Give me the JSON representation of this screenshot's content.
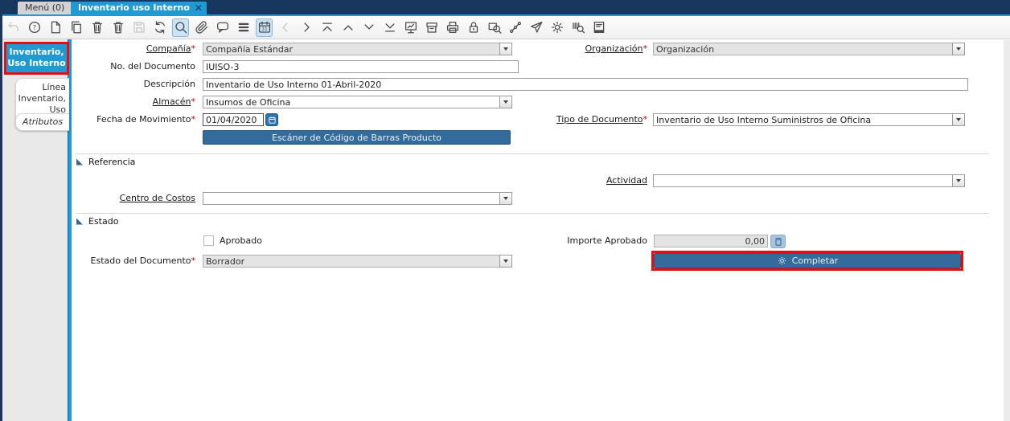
{
  "colors": {
    "navy": "#17375e",
    "accent_blue": "#1f9ad2",
    "steel_button": "#346b9d",
    "annotation_red": "#e60e0e"
  },
  "window_tabs": {
    "menu": {
      "label": "Menú (0)"
    },
    "active": {
      "label": "Inventario uso Interno",
      "close_glyph": "✕"
    }
  },
  "toolbar": {
    "icons": [
      {
        "name": "undo-icon",
        "disabled": true
      },
      {
        "name": "help-icon"
      },
      {
        "name": "new-record-icon"
      },
      {
        "name": "copy-record-icon"
      },
      {
        "name": "delete-record-icon"
      },
      {
        "name": "delete-selection-icon"
      },
      {
        "name": "save-icon",
        "disabled": true
      },
      {
        "name": "refresh-icon"
      },
      {
        "name": "find-icon",
        "highlighted": true
      },
      {
        "name": "attachment-icon"
      },
      {
        "name": "chat-icon"
      },
      {
        "name": "grid-toggle-icon"
      },
      {
        "name": "calendar-icon",
        "highlighted": true
      },
      {
        "name": "previous-icon",
        "disabled": true
      },
      {
        "name": "next-icon"
      },
      {
        "name": "first-record-icon"
      },
      {
        "name": "previous-record-icon"
      },
      {
        "name": "next-record-icon"
      },
      {
        "name": "last-record-icon"
      },
      {
        "name": "report-icon"
      },
      {
        "name": "archive-icon"
      },
      {
        "name": "print-icon"
      },
      {
        "name": "lock-icon"
      },
      {
        "name": "zoom-across-icon"
      },
      {
        "name": "workflow-icon"
      },
      {
        "name": "send-icon"
      },
      {
        "name": "process-icon"
      },
      {
        "name": "barcode-reader-icon"
      },
      {
        "name": "report-window-icon"
      }
    ]
  },
  "sidebar": {
    "tabs": [
      {
        "label": "Inventario, Uso Interno",
        "active": true,
        "highlighted": true
      },
      {
        "label": "Línea Inventario, Uso Interno"
      },
      {
        "label": "Atributos"
      }
    ]
  },
  "form": {
    "compania": {
      "label": "Compañía",
      "required": "*",
      "value": "Compañía Estándar"
    },
    "organizacion": {
      "label": "Organización",
      "required": "*",
      "value": "Organización"
    },
    "no_documento": {
      "label": "No. del Documento",
      "value": "IUISO-3"
    },
    "descripcion": {
      "label": "Descripción",
      "value": "Inventario de Uso Interno 01-Abril-2020"
    },
    "almacen": {
      "label": "Almacén",
      "required": "*",
      "value": "Insumos de Oficina"
    },
    "fecha_movimiento": {
      "label": "Fecha de Movimiento",
      "required": "*",
      "value": "01/04/2020"
    },
    "tipo_documento": {
      "label": "Tipo de Documento",
      "required": "*",
      "value": "Inventario de Uso Interno Suministros de Oficina"
    },
    "scanner_button": {
      "label": "Escáner de Código de Barras Producto"
    }
  },
  "referencia": {
    "title": "Referencia",
    "actividad": {
      "label": "Actividad",
      "value": ""
    },
    "centro_costos": {
      "label": "Centro de Costos",
      "value": ""
    }
  },
  "estado": {
    "title": "Estado",
    "aprobado": {
      "label": "Aprobado",
      "checked": false
    },
    "importe_aprobado": {
      "label": "Importe Aprobado",
      "value": "0,00"
    },
    "estado_documento": {
      "label": "Estado del Documento",
      "required": "*",
      "value": "Borrador"
    },
    "completar": {
      "label": "Completar"
    }
  }
}
